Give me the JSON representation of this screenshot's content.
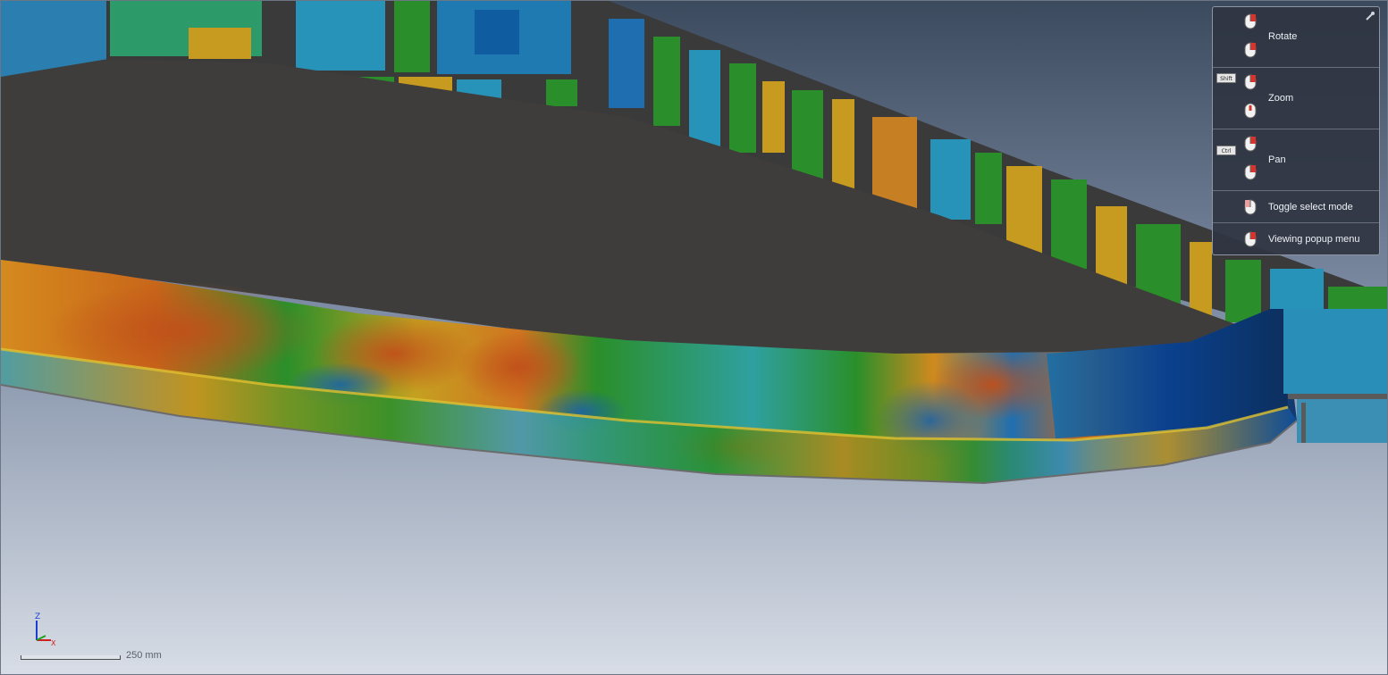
{
  "viewer": {
    "help_panel": {
      "rows": [
        {
          "label": "Rotate"
        },
        {
          "label": "Zoom",
          "modifier_key": "Shift"
        },
        {
          "label": "Pan",
          "modifier_key": "Ctrl"
        },
        {
          "label": "Toggle select mode"
        },
        {
          "label": "Viewing popup menu"
        }
      ],
      "pin_icon": "pin-icon",
      "mouse_icon": "mouse-icon"
    },
    "triad": {
      "axis_z": "Z",
      "axis_x": "X",
      "axis_y": "Y"
    },
    "scale": {
      "label": "250 mm"
    },
    "colors": {
      "background_top": "#3c4a5e",
      "background_bottom": "#d8dde6",
      "contour_low": "#0a3f8c",
      "contour_mid": "#1d8a1d",
      "contour_high": "#c04a10",
      "mesh_dark": "#3a3a3a"
    }
  }
}
